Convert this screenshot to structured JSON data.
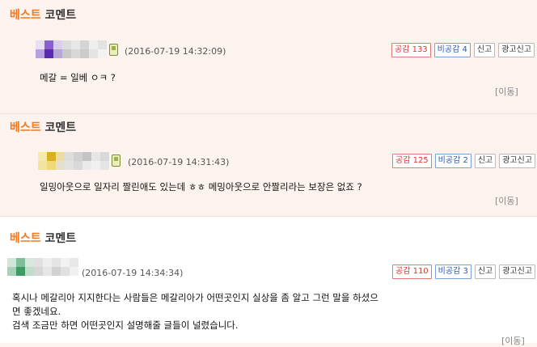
{
  "header_label": {
    "orange": "베스트",
    "dark": "코멘트"
  },
  "comments": [
    {
      "timestamp": "(2016-07-19 14:32:09)",
      "like": "공감 133",
      "dislike": "비공감 4",
      "report": "신고",
      "ad_report": "광고신고",
      "text_lines": [
        "메갈 = 일베 ㅇㅋ ?"
      ],
      "move": "[이동]"
    },
    {
      "timestamp": "(2016-07-19 14:31:43)",
      "like": "공감 125",
      "dislike": "비공감 2",
      "report": "신고",
      "ad_report": "광고신고",
      "text_lines": [
        "일밍아웃으로 일자리 짤린애도 있는데 ㅎㅎ 메밍아웃으로 안짤리라는 보장은 없죠 ?"
      ],
      "move": "[이동]"
    },
    {
      "timestamp": "(2016-07-19 14:34:34)",
      "like": "공감 110",
      "dislike": "비공감 3",
      "report": "신고",
      "ad_report": "광고신고",
      "text_lines": [
        "혹시나 메갈리아 지지한다는 사람들은 메갈리아가 어떤곳인지 실상을 좀 알고 그런 말을 하셨으",
        "면 좋겠네요.",
        "검색 조금만 하면 어떤곳인지 설명해줄 글들이 널렸습니다."
      ],
      "move": "[이동]"
    }
  ],
  "colors": {
    "accent_orange": "#f07b22",
    "like_red": "#d33333",
    "dislike_blue": "#2a58b0"
  },
  "icons": [
    "mobile-phone-icon"
  ]
}
